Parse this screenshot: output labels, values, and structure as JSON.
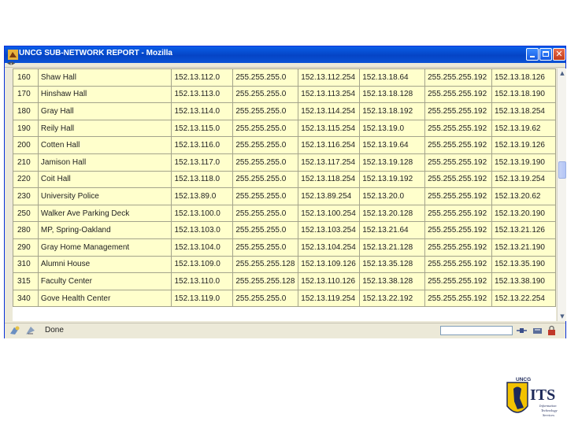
{
  "window": {
    "title": "UNCG SUB-NETWORK REPORT - Mozilla"
  },
  "status": {
    "text": "Done"
  },
  "table": {
    "rows": [
      [
        "160",
        "Shaw Hall",
        "152.13.112.0",
        "255.255.255.0",
        "152.13.112.254",
        "152.13.18.64",
        "255.255.255.192",
        "152.13.18.126"
      ],
      [
        "170",
        "Hinshaw Hall",
        "152.13.113.0",
        "255.255.255.0",
        "152.13.113.254",
        "152.13.18.128",
        "255.255.255.192",
        "152.13.18.190"
      ],
      [
        "180",
        "Gray Hall",
        "152.13.114.0",
        "255.255.255.0",
        "152.13.114.254",
        "152.13.18.192",
        "255.255.255.192",
        "152.13.18.254"
      ],
      [
        "190",
        "Reily Hall",
        "152.13.115.0",
        "255.255.255.0",
        "152.13.115.254",
        "152.13.19.0",
        "255.255.255.192",
        "152.13.19.62"
      ],
      [
        "200",
        "Cotten Hall",
        "152.13.116.0",
        "255.255.255.0",
        "152.13.116.254",
        "152.13.19.64",
        "255.255.255.192",
        "152.13.19.126"
      ],
      [
        "210",
        "Jamison Hall",
        "152.13.117.0",
        "255.255.255.0",
        "152.13.117.254",
        "152.13.19.128",
        "255.255.255.192",
        "152.13.19.190"
      ],
      [
        "220",
        "Coit Hall",
        "152.13.118.0",
        "255.255.255.0",
        "152.13.118.254",
        "152.13.19.192",
        "255.255.255.192",
        "152.13.19.254"
      ],
      [
        "230",
        "University Police",
        "152.13.89.0",
        "255.255.255.0",
        "152.13.89.254",
        "152.13.20.0",
        "255.255.255.192",
        "152.13.20.62"
      ],
      [
        "250",
        "Walker Ave Parking Deck",
        "152.13.100.0",
        "255.255.255.0",
        "152.13.100.254",
        "152.13.20.128",
        "255.255.255.192",
        "152.13.20.190"
      ],
      [
        "280",
        "MP, Spring-Oakland",
        "152.13.103.0",
        "255.255.255.0",
        "152.13.103.254",
        "152.13.21.64",
        "255.255.255.192",
        "152.13.21.126"
      ],
      [
        "290",
        "Gray Home Management",
        "152.13.104.0",
        "255.255.255.0",
        "152.13.104.254",
        "152.13.21.128",
        "255.255.255.192",
        "152.13.21.190"
      ],
      [
        "310",
        "Alumni House",
        "152.13.109.0",
        "255.255.255.128",
        "152.13.109.126",
        "152.13.35.128",
        "255.255.255.192",
        "152.13.35.190"
      ],
      [
        "315",
        "Faculty Center",
        "152.13.110.0",
        "255.255.255.128",
        "152.13.110.126",
        "152.13.38.128",
        "255.255.255.192",
        "152.13.38.190"
      ],
      [
        "340",
        "Gove Health Center",
        "152.13.119.0",
        "255.255.255.0",
        "152.13.119.254",
        "152.13.22.192",
        "255.255.255.192",
        "152.13.22.254"
      ]
    ]
  },
  "colors": {
    "table_bg": "#ffffcc",
    "titlebar": "#0a5ee8",
    "chrome": "#ece9d8"
  },
  "icons": {
    "title": "mozilla-app-icon",
    "status_left": [
      "component-bar-icon",
      "security-icon"
    ],
    "status_right": [
      "connection-icon",
      "padlock-icon"
    ],
    "logo": "uncg-its-logo"
  },
  "logo": {
    "top_text": "UNCG",
    "letters": "ITS",
    "tagline": [
      "Information",
      "Technology",
      "Services"
    ]
  }
}
